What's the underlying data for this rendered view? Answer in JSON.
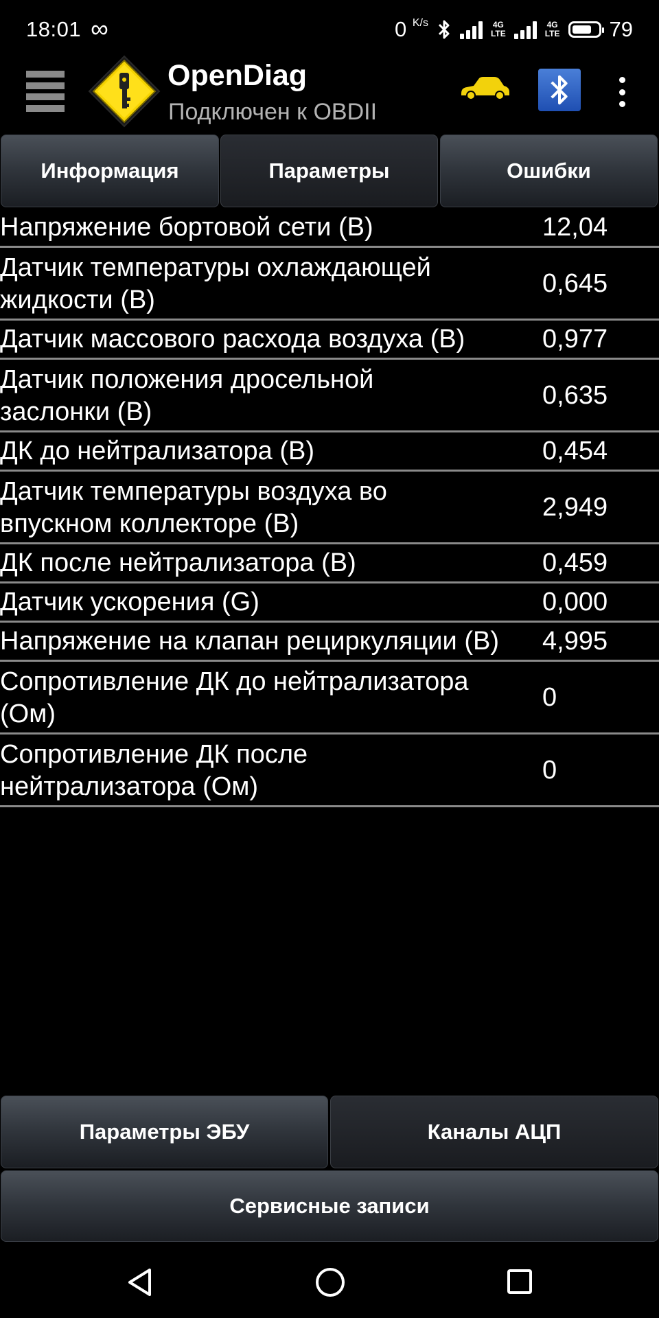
{
  "status_bar": {
    "time": "18:01",
    "speed": "0",
    "speed_unit": "K/s",
    "network_1": "4G",
    "network_1_sub": "LTE",
    "network_2": "4G",
    "network_2_sub": "LTE",
    "battery_level": "79",
    "icons": [
      "infinity-icon",
      "bluetooth-icon",
      "signal-icon",
      "battery-icon"
    ]
  },
  "app_bar": {
    "title": "OpenDiag",
    "subtitle": "Подключен к OBDII",
    "icons": [
      "menu-icon",
      "app-logo",
      "car-icon",
      "bluetooth-icon",
      "overflow-icon"
    ],
    "colors": {
      "logo_yellow": "#f5d300",
      "car_yellow": "#f2d20c",
      "bt_blue": "#2f63c8"
    }
  },
  "tabs": [
    {
      "label": "Информация",
      "active": false
    },
    {
      "label": "Параметры",
      "active": true
    },
    {
      "label": "Ошибки",
      "active": false
    }
  ],
  "parameters": [
    {
      "name": "Напряжение бортовой сети (В)",
      "value": "12,04"
    },
    {
      "name": "Датчик температуры охлаждающей жидкости (В)",
      "value": "0,645"
    },
    {
      "name": "Датчик массового расхода воздуха (В)",
      "value": "0,977"
    },
    {
      "name": "Датчик положения дросельной заслонки (В)",
      "value": "0,635"
    },
    {
      "name": "ДК до нейтрализатора (В)",
      "value": "0,454"
    },
    {
      "name": "Датчик температуры воздуха во впускном коллекторе (В)",
      "value": "2,949"
    },
    {
      "name": "ДК после нейтрализатора (В)",
      "value": "0,459"
    },
    {
      "name": "Датчик ускорения (G)",
      "value": "0,000"
    },
    {
      "name": "Напряжение на клапан рециркуляции (В)",
      "value": "4,995"
    },
    {
      "name": "Сопротивление ДК до нейтрализатора (Ом)",
      "value": "0"
    },
    {
      "name": "Сопротивление ДК после нейтрализатора (Ом)",
      "value": "0"
    }
  ],
  "bottom_buttons": {
    "ecu_params": "Параметры ЭБУ",
    "adc_channels": "Каналы АЦП",
    "service_records": "Сервисные записи"
  },
  "nav_bar": {
    "icons": [
      "back-icon",
      "home-icon",
      "recents-icon"
    ]
  }
}
